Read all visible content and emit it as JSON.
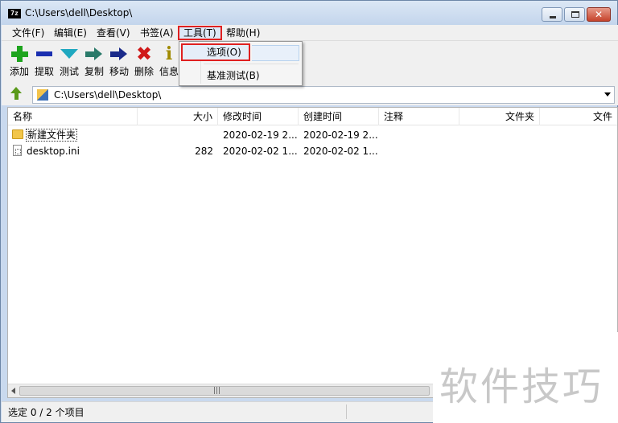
{
  "window": {
    "title": "C:\\Users\\dell\\Desktop\\",
    "app_icon": "7z",
    "close_glyph": "✕"
  },
  "menubar": {
    "items": [
      {
        "label": "文件(F)"
      },
      {
        "label": "编辑(E)"
      },
      {
        "label": "查看(V)"
      },
      {
        "label": "书签(A)"
      },
      {
        "label": "工具(T)"
      },
      {
        "label": "帮助(H)"
      }
    ]
  },
  "tools_menu": {
    "items": [
      {
        "label": "选项(O)"
      },
      {
        "label": "基准测试(B)"
      }
    ],
    "highlight_color": "#e02020"
  },
  "toolbar": {
    "items": [
      {
        "label": "添加",
        "icon": "plus-icon"
      },
      {
        "label": "提取",
        "icon": "minus-icon"
      },
      {
        "label": "测试",
        "icon": "check-icon"
      },
      {
        "label": "复制",
        "icon": "copy-arrow-icon"
      },
      {
        "label": "移动",
        "icon": "move-arrow-icon"
      },
      {
        "label": "删除",
        "icon": "delete-x-icon"
      },
      {
        "label": "信息",
        "icon": "info-icon"
      }
    ],
    "delete_glyph": "✖",
    "info_glyph": "i"
  },
  "address": {
    "path": "C:\\Users\\dell\\Desktop\\"
  },
  "filelist": {
    "columns": [
      "名称",
      "大小",
      "修改时间",
      "创建时间",
      "注释",
      "文件夹",
      "文件"
    ],
    "rows": [
      {
        "name": "新建文件夹",
        "size": "",
        "modified": "2020-02-19 2...",
        "created": "2020-02-19 2...",
        "type": "folder"
      },
      {
        "name": "desktop.ini",
        "size": "282",
        "modified": "2020-02-02 1...",
        "created": "2020-02-02 1...",
        "type": "file"
      }
    ],
    "scroll_grip": "|||"
  },
  "statusbar": {
    "text": "选定 0 / 2 个项目"
  },
  "watermark": {
    "text": "软件技巧"
  }
}
